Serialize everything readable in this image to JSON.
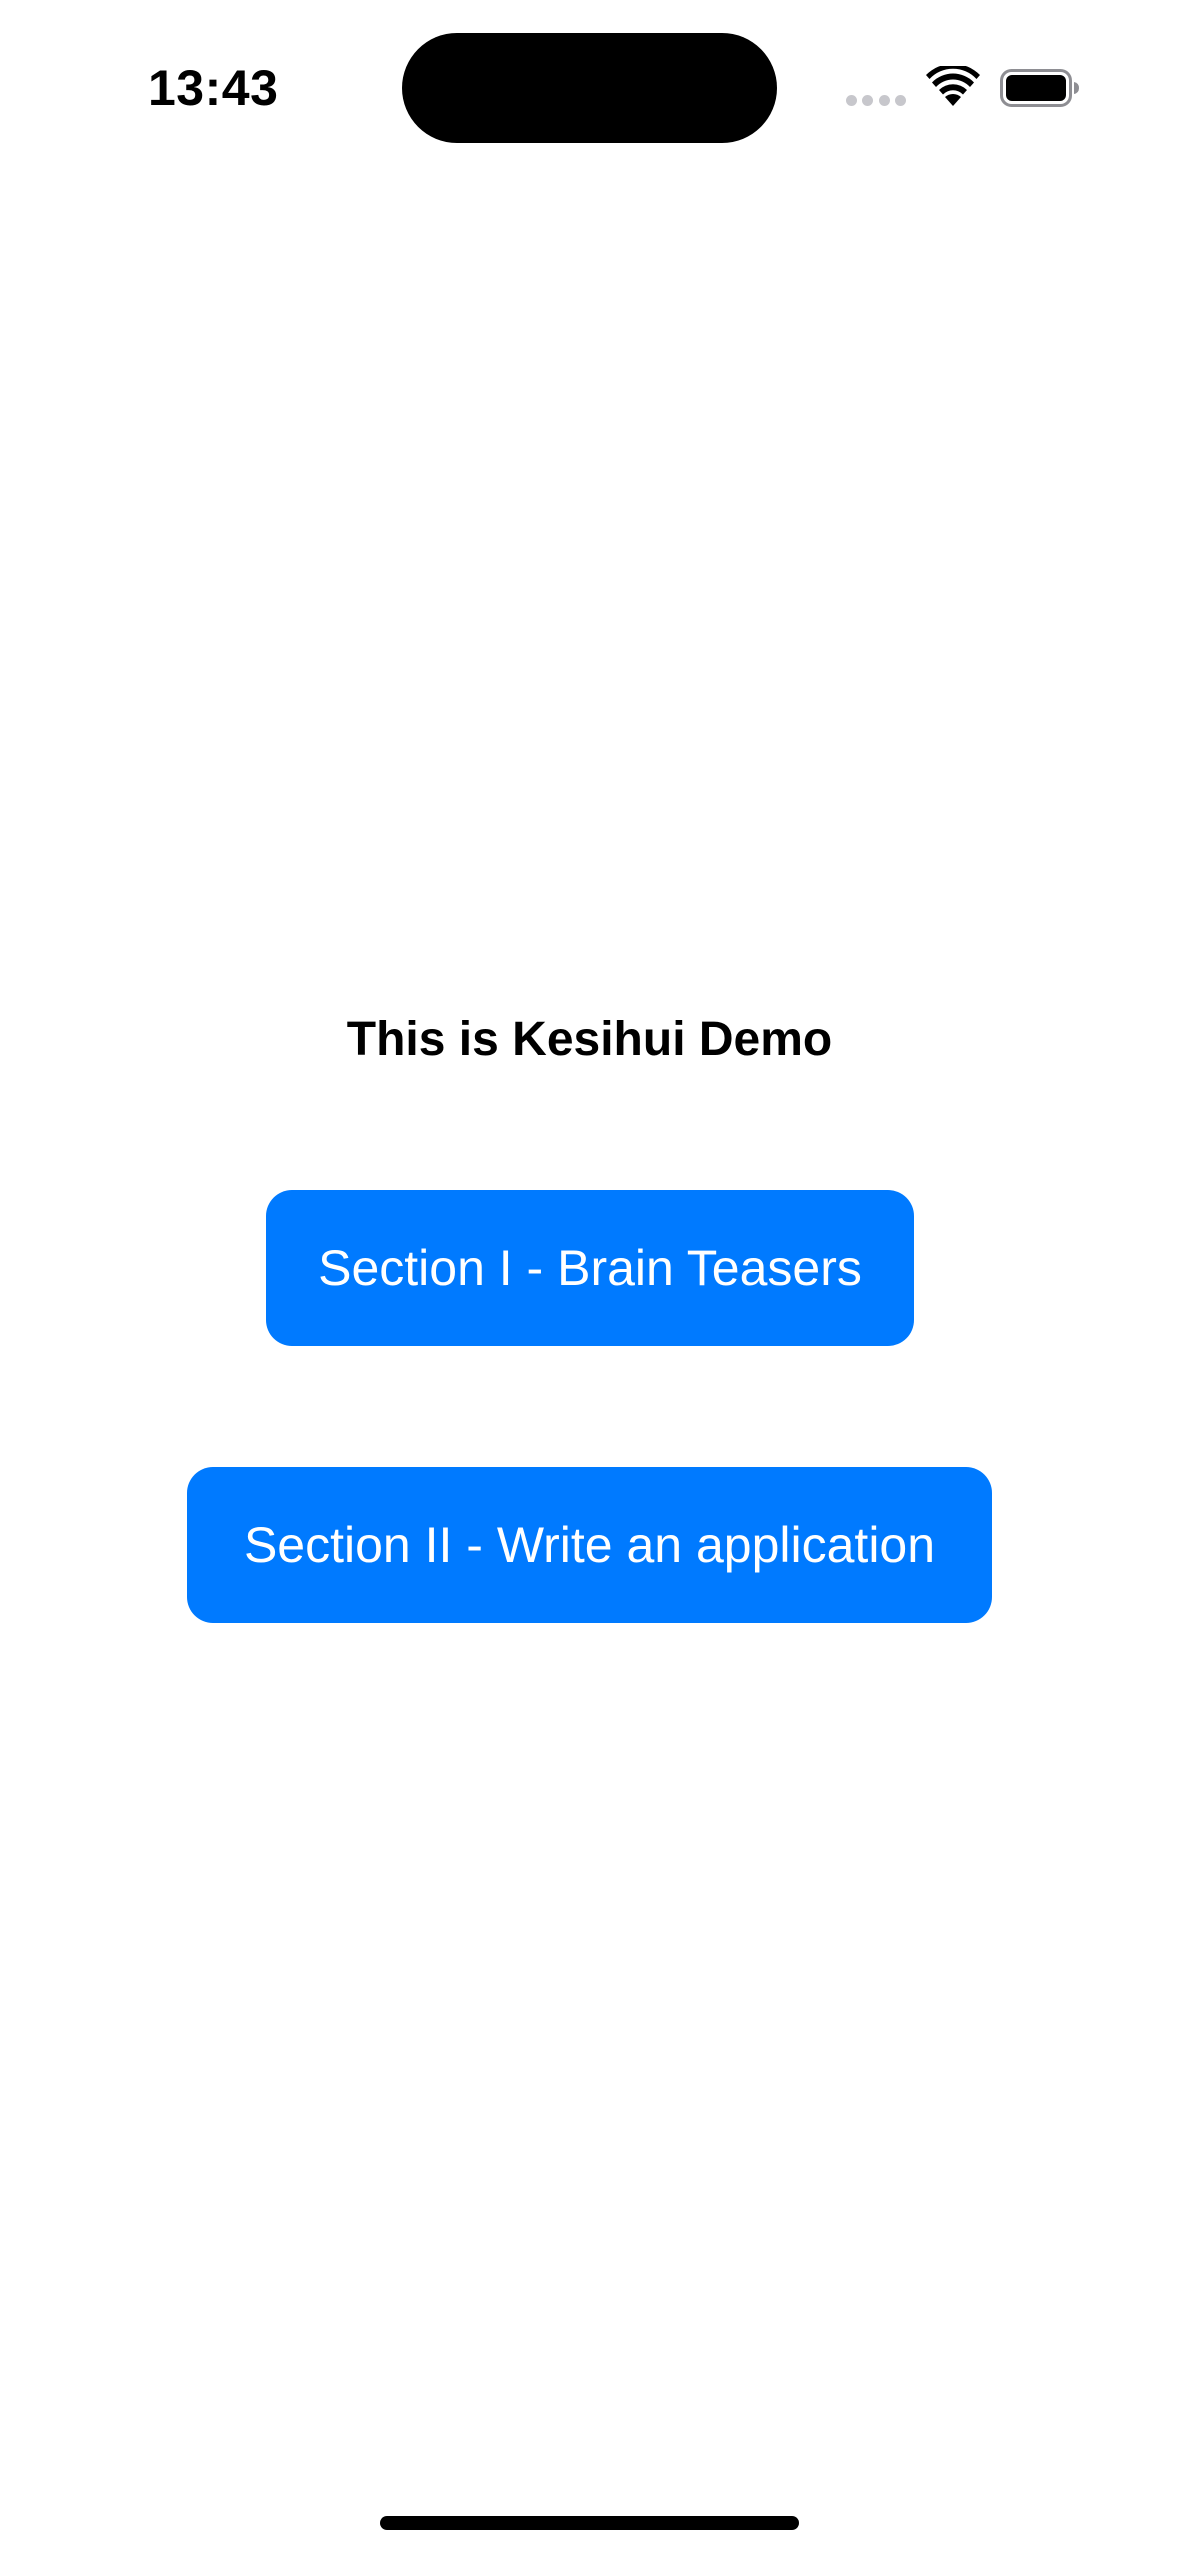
{
  "status_bar": {
    "time": "13:43",
    "icons": [
      "cellular-signal-icon",
      "wifi-icon",
      "battery-icon"
    ]
  },
  "main": {
    "title": "This is Kesihui Demo",
    "buttons": [
      {
        "label": "Section I - Brain Teasers"
      },
      {
        "label": "Section II - Write an application"
      }
    ]
  },
  "colors": {
    "accent": "#007aff",
    "background": "#ffffff",
    "text": "#000000"
  }
}
